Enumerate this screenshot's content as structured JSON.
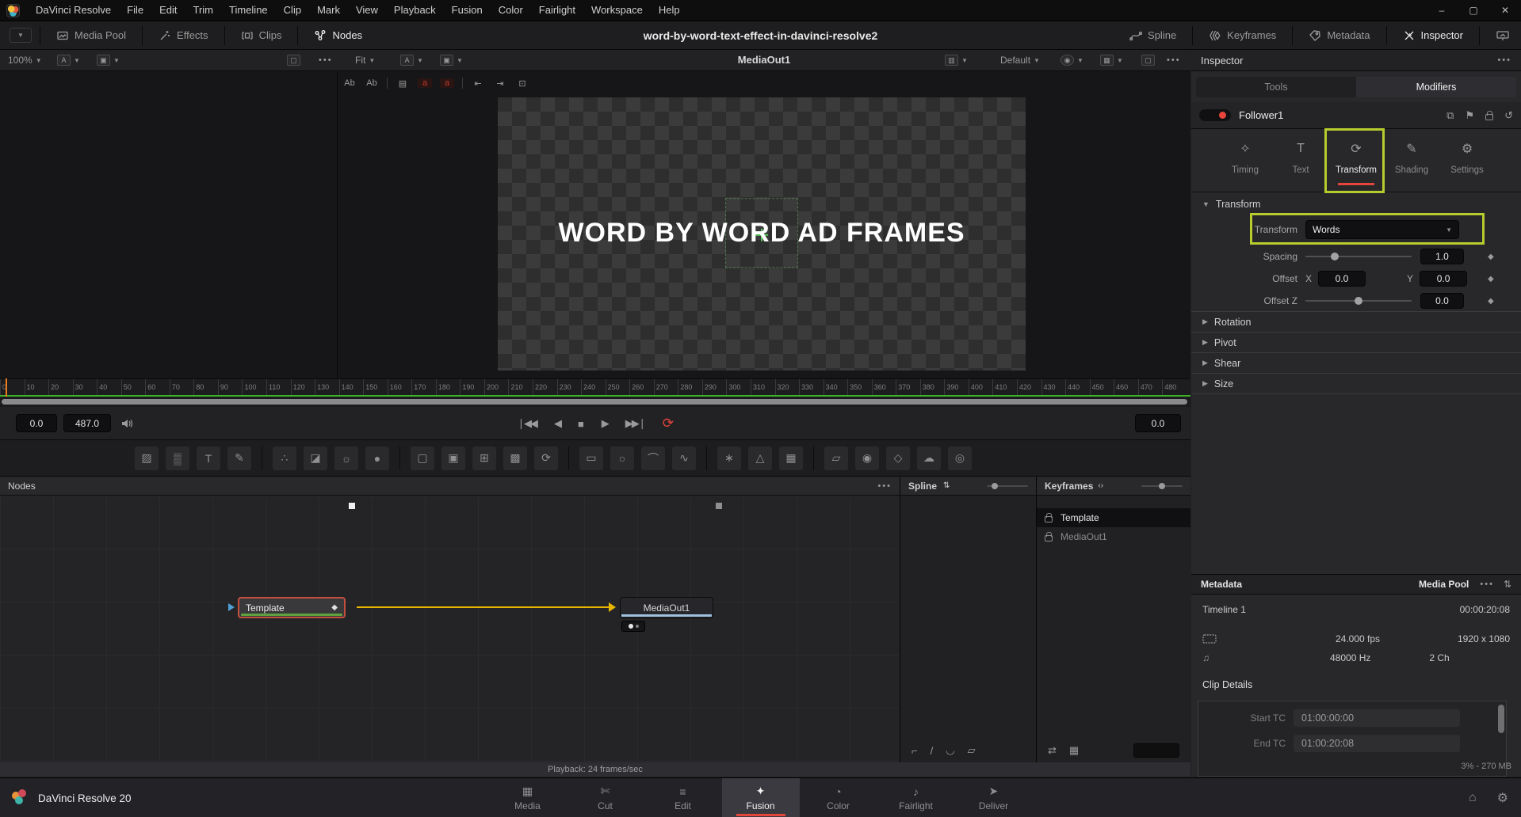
{
  "window": {
    "title": "word-by-word-text-effect-in-davinci-resolve2",
    "controls": {
      "minimize": "–",
      "maximize": "▢",
      "close": "✕"
    }
  },
  "menu_bar": {
    "items": [
      "DaVinci Resolve",
      "File",
      "Edit",
      "Trim",
      "Timeline",
      "Clip",
      "Mark",
      "View",
      "Playback",
      "Fusion",
      "Color",
      "Fairlight",
      "Workspace",
      "Help"
    ]
  },
  "toolbar": {
    "media_pool": "Media Pool",
    "effects": "Effects",
    "clips": "Clips",
    "nodes": "Nodes",
    "spline": "Spline",
    "keyframes": "Keyframes",
    "metadata": "Metadata",
    "inspector": "Inspector"
  },
  "viewer": {
    "zoom_level": "100%",
    "fit": "Fit",
    "viewer_name": "MediaOut1",
    "lut": "Default",
    "overlay_text": "WORD BY WORD AD FRAMES",
    "format_tools": [
      {
        "name": "underline-a",
        "glyph": "Ab",
        "red": false
      },
      {
        "name": "underline-b",
        "glyph": "Ab",
        "red": false
      },
      {
        "name": "align-text-icon",
        "glyph": "▤",
        "red": false
      },
      {
        "name": "baseline-a-icon",
        "glyph": "a",
        "red": true
      },
      {
        "name": "baseline-b-icon",
        "glyph": "a",
        "red": true
      },
      {
        "name": "indent-left-icon",
        "glyph": "⇤",
        "red": false
      },
      {
        "name": "indent-right-icon",
        "glyph": "⇥",
        "red": false
      },
      {
        "name": "tab-stop-icon",
        "glyph": "⊡",
        "red": false
      }
    ]
  },
  "inspector": {
    "header": "Inspector",
    "tools_tab": "Tools",
    "modifiers_tab": "Modifiers",
    "modifier_name": "Follower1",
    "subtabs": [
      {
        "label": "Timing",
        "glyph": "✧"
      },
      {
        "label": "Text",
        "glyph": "T"
      },
      {
        "label": "Transform",
        "glyph": "⟳"
      },
      {
        "label": "Shading",
        "glyph": "✎"
      },
      {
        "label": "Settings",
        "glyph": "⚙"
      }
    ],
    "active_subtab": "Transform",
    "transform_section": {
      "title": "Transform",
      "dropdown_label": "Transform",
      "dropdown_value": "Words",
      "spacing_label": "Spacing",
      "spacing_value": "1.0",
      "offset_label": "Offset",
      "x_label": "X",
      "offset_x": "0.0",
      "y_label": "Y",
      "offset_y": "0.0",
      "offset_z_label": "Offset Z",
      "offset_z": "0.0"
    },
    "collapsed_sections": [
      "Rotation",
      "Pivot",
      "Shear",
      "Size"
    ]
  },
  "metadata_panel": {
    "title": "Metadata",
    "source": "Media Pool",
    "timeline_name": "Timeline 1",
    "timeline_duration": "00:00:20:08",
    "fps": "24.000 fps",
    "resolution": "1920 x 1080",
    "sample_rate": "48000 Hz",
    "channels": "2 Ch",
    "clip_details_title": "Clip Details",
    "start_tc_label": "Start TC",
    "start_tc": "01:00:00:00",
    "end_tc_label": "End TC",
    "end_tc": "01:00:20:08"
  },
  "timeline": {
    "ticks": [
      0,
      10,
      20,
      30,
      40,
      50,
      60,
      70,
      80,
      90,
      100,
      110,
      120,
      130,
      140,
      150,
      160,
      170,
      180,
      190,
      200,
      210,
      220,
      230,
      240,
      250,
      260,
      270,
      280,
      290,
      300,
      310,
      320,
      330,
      340,
      350,
      360,
      370,
      380,
      390,
      400,
      410,
      420,
      430,
      440,
      450,
      460,
      470,
      480
    ],
    "range_start": "0.0",
    "range_end": "487.0",
    "current_frame": "0.0"
  },
  "fusion_toolbar": {
    "tools": [
      {
        "name": "background-tool",
        "glyph": "▨"
      },
      {
        "name": "fast-noise-tool",
        "glyph": "▒"
      },
      {
        "name": "text-plus-tool",
        "glyph": "T"
      },
      {
        "name": "paint-tool",
        "glyph": "✎"
      },
      {
        "divider": true
      },
      {
        "name": "particles-tool",
        "glyph": "∴"
      },
      {
        "name": "color-curves-tool",
        "glyph": "◪"
      },
      {
        "name": "color-corrector-tool",
        "glyph": "☼"
      },
      {
        "name": "blur-tool",
        "glyph": "●"
      },
      {
        "divider": true
      },
      {
        "name": "loader-tool",
        "glyph": "▢"
      },
      {
        "name": "saver-tool",
        "glyph": "▣"
      },
      {
        "name": "merge-tool",
        "glyph": "⊞"
      },
      {
        "name": "matte-control-tool",
        "glyph": "▩"
      },
      {
        "name": "transform-tool",
        "glyph": "⟳"
      },
      {
        "divider": true
      },
      {
        "name": "rectangle-mask-tool",
        "glyph": "▭"
      },
      {
        "name": "ellipse-mask-tool",
        "glyph": "○"
      },
      {
        "name": "polygon-mask-tool",
        "glyph": "⌒"
      },
      {
        "name": "bspline-mask-tool",
        "glyph": "∿"
      },
      {
        "divider": true
      },
      {
        "name": "tracker-tool",
        "glyph": "∗"
      },
      {
        "name": "planar-tracker-tool",
        "glyph": "△"
      },
      {
        "name": "grid-warp-tool",
        "glyph": "▦"
      },
      {
        "divider": true
      },
      {
        "name": "corner-pin-tool",
        "glyph": "▱"
      },
      {
        "name": "image-plane-3d-tool",
        "glyph": "◉"
      },
      {
        "name": "shape-3d-tool",
        "glyph": "◇"
      },
      {
        "name": "merge-3d-tool",
        "glyph": "☁"
      },
      {
        "name": "camera-3d-tool",
        "glyph": "◎"
      }
    ]
  },
  "panels": {
    "nodes_title": "Nodes",
    "spline_title": "Spline",
    "keyframes_title": "Keyframes",
    "node_template": "Template",
    "node_mediaout": "MediaOut1",
    "keyframe_rows": [
      {
        "label": "Template",
        "selected": true
      },
      {
        "label": "MediaOut1",
        "selected": false
      }
    ],
    "spline_bottom_icons": [
      {
        "name": "step-curve-icon",
        "glyph": "⌐"
      },
      {
        "name": "linear-curve-icon",
        "glyph": "/"
      },
      {
        "name": "smooth-curve-icon",
        "glyph": "◡"
      },
      {
        "name": "shape-box-icon",
        "glyph": "▱"
      }
    ],
    "kf_bottom_icons": [
      {
        "name": "spread-keyframes-icon",
        "glyph": "⇄"
      },
      {
        "name": "snap-grid-icon",
        "glyph": "▦"
      }
    ]
  },
  "status": {
    "playback": "Playback: 24 frames/sec",
    "memory": "3% - 270 MB"
  },
  "page_bar": {
    "brand": "DaVinci Resolve 20",
    "active": "Fusion",
    "pages": [
      {
        "label": "Media",
        "glyph": "▦"
      },
      {
        "label": "Cut",
        "glyph": "✄"
      },
      {
        "label": "Edit",
        "glyph": "≡"
      },
      {
        "label": "Fusion",
        "glyph": "✦"
      },
      {
        "label": "Color",
        "glyph": "◔"
      },
      {
        "label": "Fairlight",
        "glyph": "♪"
      },
      {
        "label": "Deliver",
        "glyph": "➤"
      }
    ]
  },
  "colors": {
    "accent_green": "#b7cc2d",
    "accent_red": "#e5453a",
    "wire_yellow": "#e8b500",
    "render_green": "#3fae29"
  }
}
